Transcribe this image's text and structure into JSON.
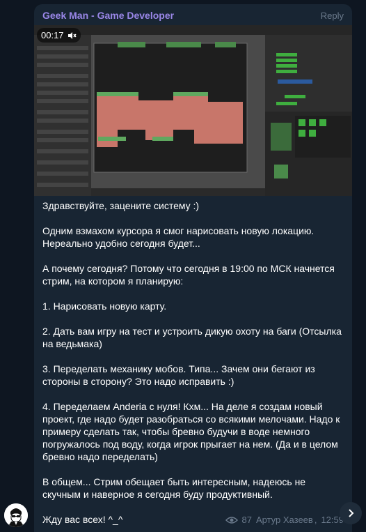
{
  "message": {
    "sender": "Geek Man - Game Developer",
    "reply_label": "Reply",
    "video": {
      "duration": "00:17",
      "muted_icon": "speaker-muted-icon"
    },
    "paragraphs": [
      "Здравствуйте, зацените систему :)",
      "Одним взмахом курсора я смог нарисовать новую локацию. Нереально удобно сегодня будет...",
      "А почему сегодня? Потому что сегодня в 19:00 по МСК начнется стрим, на котором я планирую:",
      "1. Нарисовать новую карту.",
      "2. Дать вам игру на тест и устроить дикую охоту на баги (Отсылка на ведьмака)",
      "3. Переделать механику мобов. Типа... Зачем они бегают из стороны в сторону? Это надо исправить :)",
      "4. Переделаем Anderia с нуля! Кхм... На деле я создам новый проект, где надо будет разобраться со всякими мелочами. Надо к примеру сделать так, чтобы бревно будучи в воде немного погружалось под воду, когда игрок прыгает на нем. (Да и в целом бревно надо переделать)",
      "В общем... Стрим обещает быть интересным, надеюсь не скучным и наверное я сегодня буду продуктивный.",
      "Жду вас всех! ^_^"
    ],
    "views": "87",
    "author": "Артур Хазеев",
    "time": "12:59"
  },
  "colors": {
    "background": "#0e1621",
    "bubble": "#182533",
    "sender": "#9a87e8",
    "meta": "#6b7a8c"
  }
}
